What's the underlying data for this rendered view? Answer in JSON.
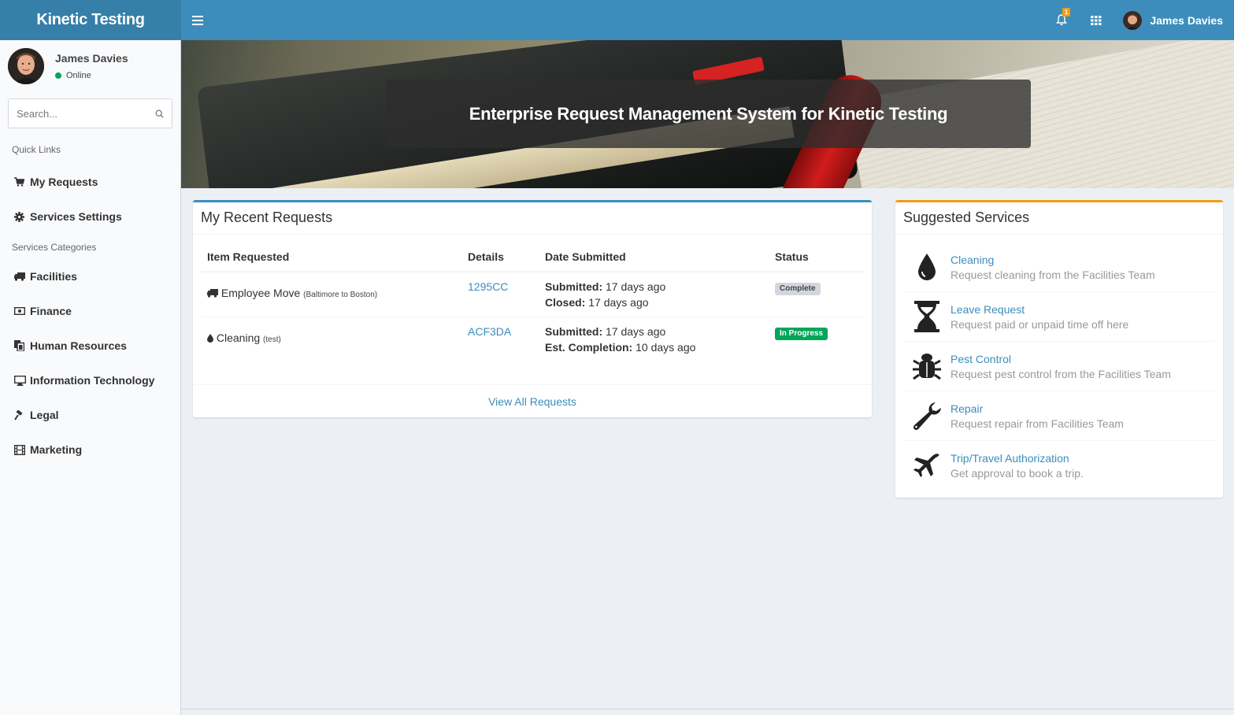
{
  "brand": "Kinetic Testing",
  "topbar": {
    "notification_count": "1",
    "user_name": "James Davies"
  },
  "sidebar": {
    "user_name": "James Davies",
    "status": "Online",
    "search_placeholder": "Search...",
    "quick_links_header": "Quick Links",
    "quick_links": [
      {
        "label": "My Requests",
        "icon": "shopping-cart-icon"
      },
      {
        "label": "Services Settings",
        "icon": "gear-icon"
      }
    ],
    "categories_header": "Services Categories",
    "categories": [
      {
        "label": "Facilities",
        "icon": "truck-icon"
      },
      {
        "label": "Finance",
        "icon": "money-icon"
      },
      {
        "label": "Human Resources",
        "icon": "files-icon"
      },
      {
        "label": "Information Technology",
        "icon": "monitor-icon"
      },
      {
        "label": "Legal",
        "icon": "gavel-icon"
      },
      {
        "label": "Marketing",
        "icon": "film-icon"
      }
    ]
  },
  "hero": {
    "title": "Enterprise Request Management System for Kinetic Testing"
  },
  "recent_requests": {
    "title": "My Recent Requests",
    "columns": [
      "Item Requested",
      "Details",
      "Date Submitted",
      "Status"
    ],
    "rows": [
      {
        "item": "Employee Move",
        "note": "(Baltimore to Boston)",
        "icon": "truck-icon",
        "details": "1295CC",
        "line1_label": "Submitted:",
        "line1_value": "17 days ago",
        "line2_label": "Closed:",
        "line2_value": "17 days ago",
        "status": "Complete",
        "status_color": "#d2d6de"
      },
      {
        "item": "Cleaning",
        "note": "(test)",
        "icon": "droplet-icon",
        "details": "ACF3DA",
        "line1_label": "Submitted:",
        "line1_value": "17 days ago",
        "line2_label": "Est. Completion:",
        "line2_value": "10 days ago",
        "status": "In Progress",
        "status_color": "#00a65a"
      }
    ],
    "footer_link": "View All Requests"
  },
  "suggested_services": {
    "title": "Suggested Services",
    "items": [
      {
        "title": "Cleaning",
        "desc": "Request cleaning from the Facilities Team",
        "icon": "droplet-icon"
      },
      {
        "title": "Leave Request",
        "desc": "Request paid or unpaid time off here",
        "icon": "hourglass-icon"
      },
      {
        "title": "Pest Control",
        "desc": "Request pest control from the Facilities Team",
        "icon": "bug-icon"
      },
      {
        "title": "Repair",
        "desc": "Request repair from Facilities Team",
        "icon": "wrench-icon"
      },
      {
        "title": "Trip/Travel Authorization",
        "desc": "Get approval to book a trip.",
        "icon": "plane-icon"
      }
    ]
  },
  "colors": {
    "primary": "#3c8dbc",
    "brand_bg": "#367fa9",
    "warning": "#f39c12",
    "success": "#00a65a"
  }
}
